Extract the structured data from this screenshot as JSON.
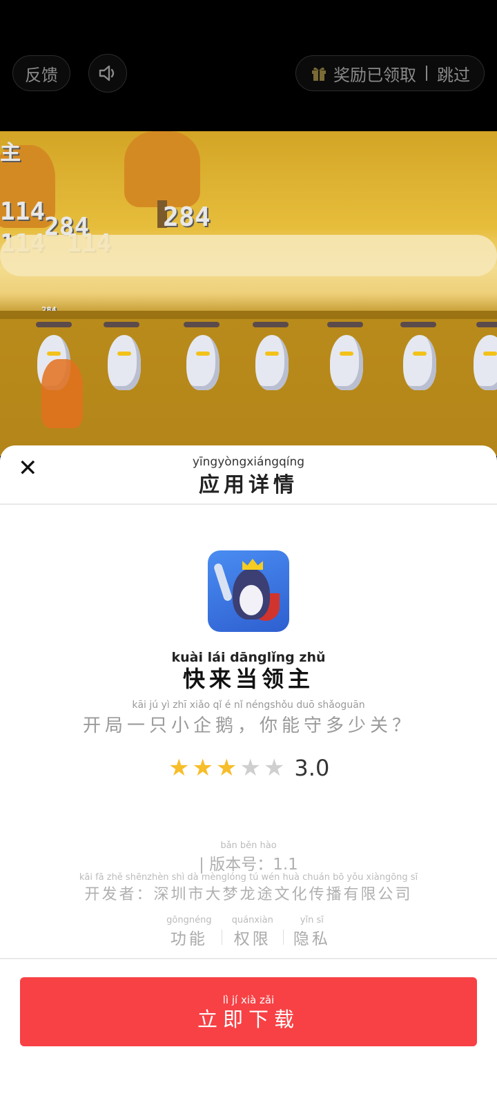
{
  "topbar": {
    "feedback_label": "反馈",
    "sound_icon": "speaker-icon",
    "gift_icon": "gift-icon",
    "reward_label": "奖励已领取",
    "skip_label": "跳过"
  },
  "scene": {
    "damage_numbers": [
      "114",
      "284",
      "114",
      "114",
      "284",
      "284"
    ],
    "small_label": "主"
  },
  "sheet": {
    "close_icon": "close-icon",
    "title_pinyin": "yīngyòngxiángqíng",
    "title": "应用详情"
  },
  "app": {
    "icon": "penguin-king-app-icon",
    "name_pinyin": "kuài lái dānglǐng zhǔ",
    "name": "快来当领主",
    "desc_pinyin": "kāi jú yì zhī xiǎo qǐ é    nǐ néngshǒu duō shǎoguān",
    "desc": "开局一只小企鹅，你能守多少关？",
    "rating": 3,
    "rating_max": 5,
    "rating_text": "3.0",
    "version_pinyin": "bǎn běn hào",
    "version": "| 版本号：1.1",
    "developer_pinyin": "kāi fā zhě   shēnzhèn shì dà mènglóng tú wén huà chuán bō yǒu xiàngōng sī",
    "developer": "开发者：深圳市大梦龙途文化传播有限公司"
  },
  "links": [
    {
      "pinyin": "gōngnéng",
      "label": "功能"
    },
    {
      "pinyin": "quánxiàn",
      "label": "权限"
    },
    {
      "pinyin": "yǐn sī",
      "label": "隐私"
    }
  ],
  "download": {
    "pinyin": "lì  jí  xià  zǎi",
    "label": "立即下载",
    "color": "#f74145"
  }
}
